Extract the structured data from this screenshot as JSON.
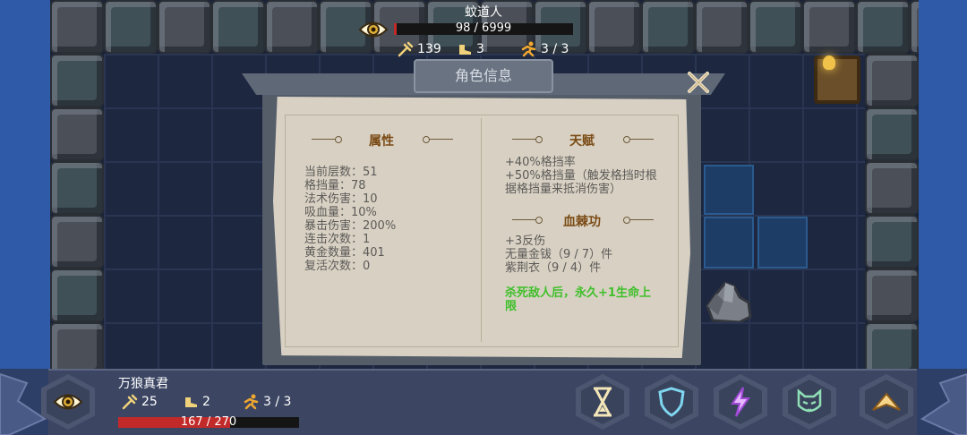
{
  "enemy": {
    "name": "蚊道人",
    "hp_text": "98 / 6999",
    "hp_current": 98,
    "hp_max": 6999,
    "attack": "139",
    "defense": "3",
    "speed": "3 / 3"
  },
  "dialog": {
    "title": "角色信息",
    "attributes": {
      "title": "属性",
      "lines": [
        "当前层数：51",
        "格挡量：78",
        "法术伤害：10",
        "吸血量：10%",
        "暴击伤害：200%",
        "连击次数：1",
        "黄金数量：401",
        "复活次数：0"
      ]
    },
    "talent": {
      "title": "天赋",
      "lines": [
        "+40%格挡率",
        "+50%格挡量（触发格挡时根",
        "据格挡量来抵消伤害）"
      ]
    },
    "skill": {
      "title": "血棘功",
      "lines": [
        "+3反伤",
        "无量金钹（9 / 7）件",
        "紫荆衣（9 / 4）件"
      ],
      "green_note": "杀死敌人后，永久+1生命上限"
    }
  },
  "player": {
    "name": "万狼真君",
    "attack": "25",
    "defense": "2",
    "speed": "3 / 3",
    "hp_text": "167 / 270",
    "hp_current": 167,
    "hp_max": 270
  },
  "actions": [
    {
      "icon": "hourglass-icon"
    },
    {
      "icon": "shield-icon"
    },
    {
      "icon": "lightning-icon"
    },
    {
      "icon": "cat-mask-icon"
    },
    {
      "icon": "arrow-up-icon"
    }
  ],
  "colors": {
    "hp_red": "#c22a2a",
    "note_green": "#3fbf2a",
    "section_title": "#7a4a14"
  }
}
